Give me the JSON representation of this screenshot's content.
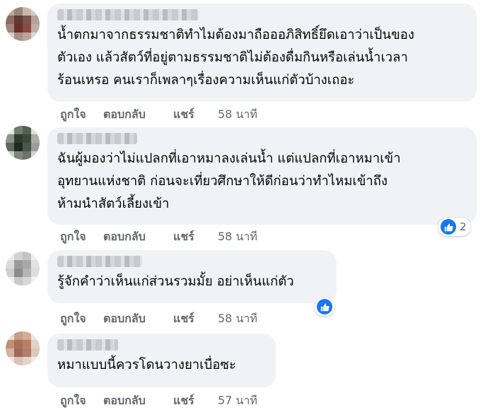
{
  "comments": [
    {
      "text": "น้ำตกมาจากธรรมชาติทำไมต้องมาถือออภิสิทธิ์ยึดเอาว่าเป็นของ\nตัวเอง แล้วสัตว์ที่อยู่ตามธรรมชาติไม่ต้องดื่มกินหรือเล่นน้ำเวลา\nร้อนเหรอ คนเราก็เพลาๆเรื่องความเห็นแก่ตัวบ้างเถอะ",
      "like": "ถูกใจ",
      "reply": "ตอบกลับ",
      "share": "แชร์",
      "time": "58 นาที",
      "avatar_colors": [
        "#bba79e",
        "#9c8477",
        "#c9b7ad",
        "#d8cbc4",
        "#8a6b61",
        "#5d3c35",
        "#7c5449",
        "#b7a096",
        "#a3837a",
        "#6e2e2a",
        "#8a4a42",
        "#c2aea6",
        "#d9ccc6",
        "#a5928b",
        "#b8a49d",
        "#e0d6d1"
      ]
    },
    {
      "text": "ฉันผู้มองว่าไม่แปลกที่เอาหมาลงเล่นน้ำ แต่แปลกที่เอาหมาเข้า\nอุทยานแห่งชาติ ก่อนจะเที่ยวศึกษาให้ดีก่อนว่าทำไหมเข้าถึง\nห้ามนำสัตว์เลี้ยงเข้า",
      "like": "ถูกใจ",
      "reply": "ตอบกลับ",
      "share": "แชร์",
      "time": "58 นาที",
      "reaction_count": "2",
      "avatar_colors": [
        "#e3e6e3",
        "#6f7d6b",
        "#53624f",
        "#dcdfdb",
        "#8a9587",
        "#2f3a2d",
        "#3d4a3b",
        "#a7afa5",
        "#5e685c",
        "#1f2a1f",
        "#4b554a",
        "#98a096",
        "#c9cec8",
        "#7d867b",
        "#6a7368",
        "#d0d5cf"
      ]
    },
    {
      "text": "รู้จักคำว่าเห็นแก่ส่วนรวมมั้ย อย่าเห็นแก่ตัว",
      "like": "ถูกใจ",
      "reply": "ตอบกลับ",
      "share": "แชร์",
      "time": "58 นาที",
      "avatar_colors": [
        "#ececec",
        "#d2d2d2",
        "#c4c4c4",
        "#eeeeee",
        "#dadada",
        "#9a9a9a",
        "#a8a8a8",
        "#e2e2e2",
        "#cfcfcf",
        "#8c8c8c",
        "#b4b4b4",
        "#dedede",
        "#f0f0f0",
        "#c9c9c9",
        "#d7d7d7",
        "#f3f3f3"
      ]
    },
    {
      "text": "หมาแบบนี้ควรโดนวางยาเบื่อซะ",
      "like": "ถูกใจ",
      "reply": "ตอบกลับ",
      "share": "แชร์",
      "time": "57 นาที",
      "avatar_colors": [
        "#e8dcd4",
        "#c79d88",
        "#d4ab96",
        "#efe6e0",
        "#c28e76",
        "#a8705a",
        "#b98068",
        "#e2d2c8",
        "#d3b3a2",
        "#9d6a58",
        "#ae7e6b",
        "#dcc8bc",
        "#efe5df",
        "#d9c2b5",
        "#e3d3ca",
        "#f3ece8"
      ]
    }
  ]
}
